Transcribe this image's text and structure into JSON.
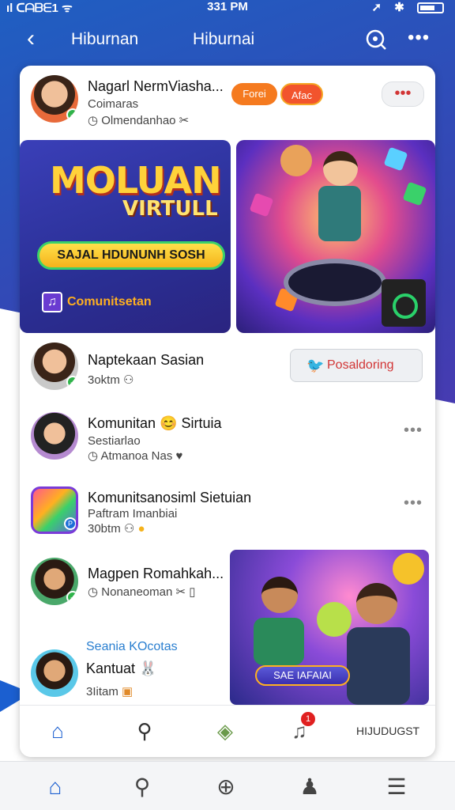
{
  "status_bar": {
    "carrier": "ıl ᑕᗩᗷᗴ1 ᯤ",
    "time": "331 PM",
    "icons": "➚ ✱"
  },
  "nav": {
    "back_icon": "‹",
    "title_left": "Hiburnan",
    "title_right": "Hiburnai",
    "more_icon": "•••"
  },
  "post_header": {
    "name": "Nagarl NermViasha...",
    "subtitle": "Coimaras",
    "meta": "Olmendanhao",
    "pill_1": "Forei",
    "pill_2": "Afac"
  },
  "banner_left": {
    "title": "MOLUAN",
    "subtitle": "VIRTULL",
    "button": "SAJAL HDUNUNH SOSH",
    "footer": "Comunitsetan"
  },
  "rows": [
    {
      "name": "Naptekaan Sasian",
      "meta": "3oktm",
      "action": "Posaldoring"
    },
    {
      "name": "Komunitan 😊 Sirtuia",
      "sub": "Sestiarlao",
      "meta": "Atmanoa Nas"
    },
    {
      "name": "Komunitsanosiml Sietuian",
      "sub": "Paftram Imanbiai",
      "meta": "30btm"
    },
    {
      "name": "Magpen Romahkah...",
      "meta": "Nonaneoman"
    },
    {
      "link": "Seania KOcotas",
      "name": "Kantuat 🐰",
      "meta": "3Iitam"
    }
  ],
  "bottom_image": {
    "badge": "SAE IAFAIAI"
  },
  "inner_tabs": {
    "label": "HIJUDUGST",
    "badge": "1"
  },
  "colors": {
    "accent_blue": "#1b5fd0",
    "orange": "#f57a1f",
    "red": "#d23535",
    "green": "#2fb34a"
  },
  "icons": {
    "home": "home-icon",
    "search": "search-icon",
    "add": "plus-circle-icon",
    "profile": "person-icon",
    "menu": "hamburger-icon"
  }
}
